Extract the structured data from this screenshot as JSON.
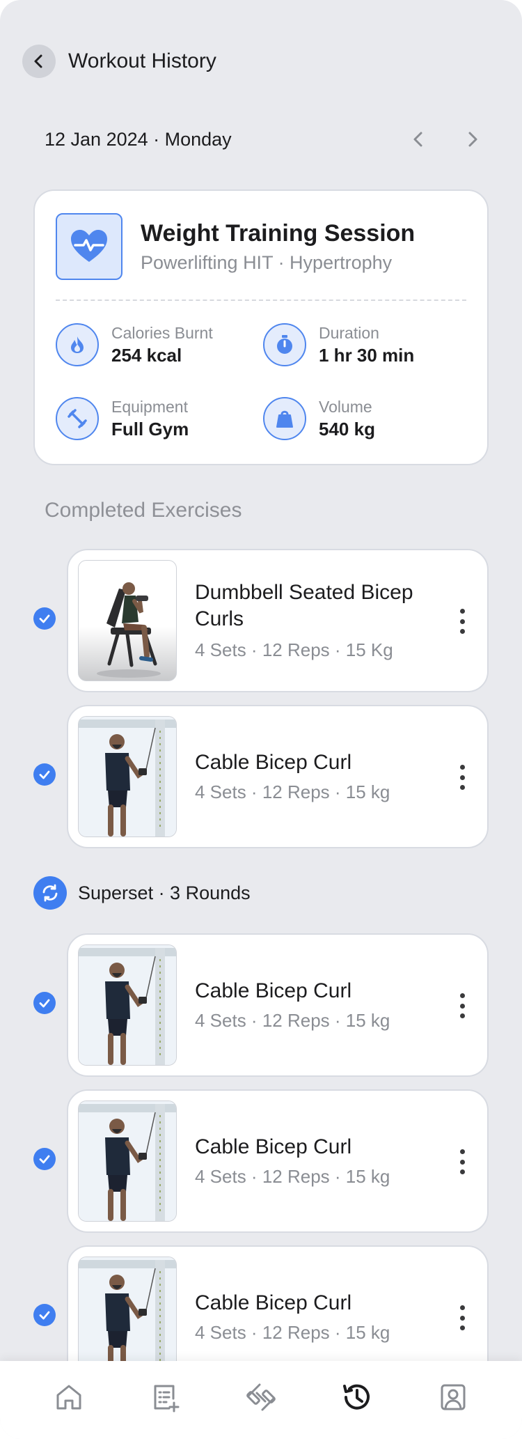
{
  "header": {
    "title": "Workout History"
  },
  "date": {
    "label": "12 Jan 2024 · Monday"
  },
  "summary": {
    "title": "Weight Training Session",
    "subtitle": "Powerlifting HIT · Hypertrophy",
    "icon": "heart-pulse-icon",
    "stats": [
      {
        "label": "Calories Burnt",
        "value": "254 kcal",
        "icon": "flame-icon"
      },
      {
        "label": "Duration",
        "value": "1 hr 30 min",
        "icon": "stopwatch-icon"
      },
      {
        "label": "Equipment",
        "value": "Full Gym",
        "icon": "dumbbell-icon"
      },
      {
        "label": "Volume",
        "value": "540 kg",
        "icon": "weight-icon"
      }
    ]
  },
  "completed": {
    "title": "Completed Exercises",
    "exercises": [
      {
        "name": "Dumbbell Seated Bicep Curls",
        "meta": "4 Sets · 12 Reps · 15 Kg"
      },
      {
        "name": "Cable Bicep Curl",
        "meta": "4 Sets · 12 Reps · 15 kg"
      }
    ]
  },
  "superset": {
    "label": "Superset · 3 Rounds",
    "exercises": [
      {
        "name": "Cable Bicep Curl",
        "meta": "4 Sets · 12 Reps · 15 kg"
      },
      {
        "name": "Cable Bicep Curl",
        "meta": "4 Sets · 12 Reps · 15 kg"
      },
      {
        "name": "Cable Bicep Curl",
        "meta": "4 Sets · 12 Reps · 15 kg"
      }
    ]
  },
  "nav": {
    "items": [
      "home-icon",
      "add-plan-icon",
      "dumbbell-icon",
      "history-icon",
      "profile-icon"
    ],
    "active": "history-icon"
  },
  "colors": {
    "accent": "#3f7ef0",
    "background": "#e9eaee",
    "card": "#ffffff",
    "muted": "#8a8d93"
  }
}
